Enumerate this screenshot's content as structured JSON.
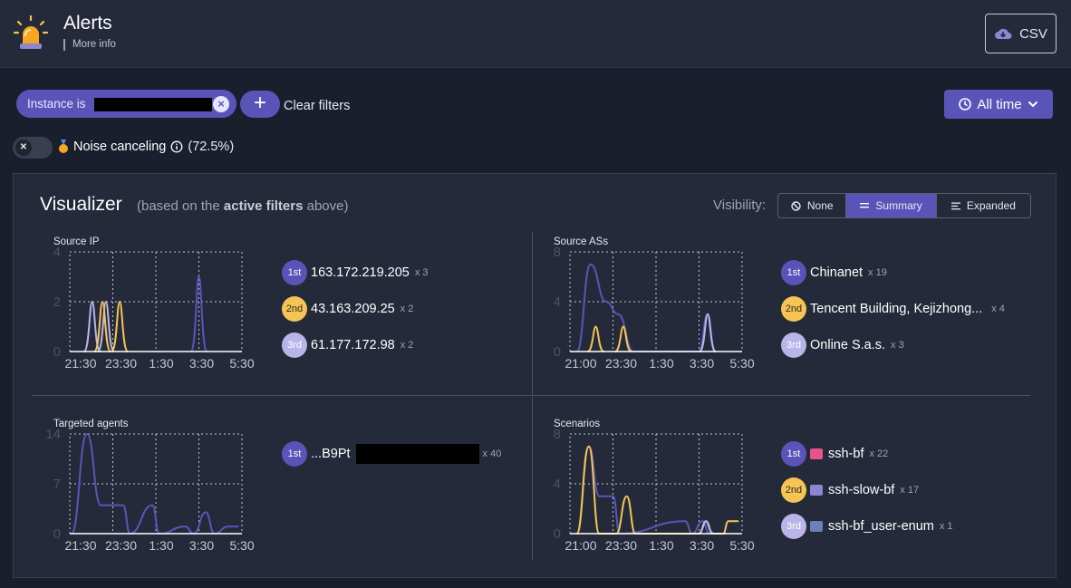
{
  "header": {
    "title": "Alerts",
    "more_info": "More info",
    "csv_label": "CSV"
  },
  "filters": {
    "chip_prefix": "Instance is",
    "clear_label": "Clear filters",
    "time_label": "All time"
  },
  "noise": {
    "label": "Noise canceling",
    "percent": "(72.5%)"
  },
  "visualizer": {
    "title": "Visualizer",
    "sub_pre": "(based on the ",
    "sub_bold": "active filters",
    "sub_post": " above)",
    "visibility_label": "Visibility:",
    "options": {
      "none": "None",
      "summary": "Summary",
      "expanded": "Expanded"
    },
    "active_option": "Summary"
  },
  "colors": {
    "accent": "#5b54b8",
    "second": "#f5c453",
    "third": "#b9b5e8"
  },
  "quadrants": {
    "source_ip": {
      "label": "Source IP",
      "ranks": [
        {
          "badge": "1st",
          "name": "163.172.219.205",
          "count": "x 3"
        },
        {
          "badge": "2nd",
          "name": "43.163.209.25",
          "count": "x 2"
        },
        {
          "badge": "3rd",
          "name": "61.177.172.98",
          "count": "x 2"
        }
      ]
    },
    "source_as": {
      "label": "Source ASs",
      "ranks": [
        {
          "badge": "1st",
          "name": "Chinanet",
          "count": "x 19"
        },
        {
          "badge": "2nd",
          "name": "Tencent Building, Kejizhong...",
          "count": "x 4"
        },
        {
          "badge": "3rd",
          "name": "Online S.a.s.",
          "count": "x 3"
        }
      ]
    },
    "agents": {
      "label": "Targeted agents",
      "ranks": [
        {
          "badge": "1st",
          "name": "...B9Pt",
          "count": "x 40"
        }
      ]
    },
    "scenarios": {
      "label": "Scenarios",
      "ranks": [
        {
          "badge": "1st",
          "name": "ssh-bf",
          "count": "x 22",
          "icon": "ssh-bf-icon"
        },
        {
          "badge": "2nd",
          "name": "ssh-slow-bf",
          "count": "x 17",
          "icon": "ssh-slow-bf-icon"
        },
        {
          "badge": "3rd",
          "name": "ssh-bf_user-enum",
          "count": "x 1",
          "icon": "user-enum-icon"
        }
      ]
    }
  },
  "chart_data": [
    {
      "type": "line",
      "title": "Source IP",
      "x": [
        "21:30",
        "23:30",
        "1:30",
        "3:30",
        "5:30"
      ],
      "ylim": [
        0,
        4
      ],
      "yticks": [
        0,
        2,
        4
      ],
      "grid": true,
      "series": [
        {
          "peaks": [
            [
              20.8,
              2
            ],
            [
              21.6,
              2
            ]
          ],
          "color": "#b9b5e8"
        },
        {
          "peaks": [
            [
              21.4,
              2
            ],
            [
              22.4,
              2
            ]
          ],
          "color": "#f5c453"
        },
        {
          "peaks": [
            [
              3.0,
              3
            ]
          ],
          "color": "#5b54b8"
        }
      ]
    },
    {
      "type": "line",
      "title": "Source ASs",
      "x": [
        "21:00",
        "23:30",
        "1:30",
        "3:30",
        "5:30"
      ],
      "ylim": [
        0,
        8
      ],
      "yticks": [
        0,
        4,
        8
      ],
      "grid": true,
      "series": [
        {
          "points": [
            [
              19.9,
              0
            ],
            [
              20.7,
              7
            ],
            [
              21.6,
              4
            ],
            [
              22.3,
              3
            ],
            [
              23.2,
              0
            ],
            [
              3.0,
              0
            ],
            [
              3.5,
              3
            ],
            [
              3.9,
              0
            ]
          ],
          "color": "#5b54b8"
        },
        {
          "peaks": [
            [
              21.0,
              2
            ],
            [
              22.6,
              2
            ]
          ],
          "color": "#f5c453"
        },
        {
          "peaks": [
            [
              3.5,
              3
            ]
          ],
          "color": "#b9b5e8"
        }
      ]
    },
    {
      "type": "line",
      "title": "Targeted agents",
      "x": [
        "21:30",
        "23:30",
        "1:30",
        "3:30",
        "5:30"
      ],
      "ylim": [
        0,
        14
      ],
      "yticks": [
        0,
        7,
        14
      ],
      "grid": true,
      "series": [
        {
          "points": [
            [
              19.6,
              0
            ],
            [
              20.5,
              14
            ],
            [
              21.3,
              4
            ],
            [
              22.2,
              4
            ],
            [
              22.6,
              4
            ],
            [
              23.0,
              0
            ],
            [
              0.3,
              4
            ],
            [
              0.7,
              0
            ],
            [
              2.2,
              1
            ],
            [
              2.7,
              0
            ],
            [
              3.4,
              3
            ],
            [
              3.9,
              0
            ],
            [
              4.7,
              1
            ],
            [
              5.3,
              1
            ]
          ],
          "color": "#5b54b8"
        }
      ]
    },
    {
      "type": "line",
      "title": "Scenarios",
      "x": [
        "21:00",
        "23:30",
        "1:30",
        "3:30",
        "5:30"
      ],
      "ylim": [
        0,
        8
      ],
      "yticks": [
        0,
        4,
        8
      ],
      "grid": true,
      "series": [
        {
          "points": [
            [
              19.9,
              0
            ],
            [
              20.6,
              7
            ],
            [
              21.2,
              3
            ],
            [
              22.0,
              3
            ],
            [
              22.4,
              0
            ],
            [
              2.2,
              1
            ],
            [
              2.6,
              0
            ],
            [
              3.2,
              1
            ],
            [
              3.6,
              0
            ],
            [
              4.4,
              0
            ],
            [
              4.6,
              0
            ]
          ],
          "color": "#5b54b8"
        },
        {
          "points": [
            [
              19.9,
              0
            ],
            [
              20.6,
              7
            ],
            [
              21.2,
              0
            ],
            [
              22.2,
              0
            ],
            [
              22.8,
              3
            ],
            [
              23.3,
              0
            ],
            [
              3.0,
              0
            ],
            [
              3.4,
              1
            ],
            [
              3.8,
              0
            ],
            [
              4.4,
              0
            ],
            [
              4.7,
              1
            ],
            [
              5.3,
              1
            ]
          ],
          "color": "#f5c453"
        },
        {
          "peaks": [
            [
              3.4,
              1
            ]
          ],
          "color": "#b9b5e8"
        }
      ]
    }
  ]
}
